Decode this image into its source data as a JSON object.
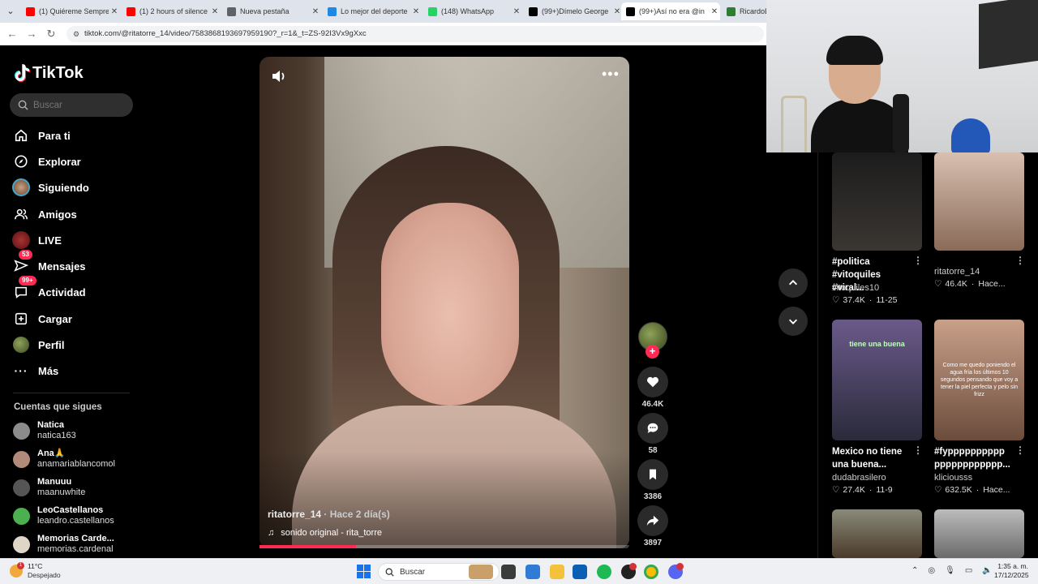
{
  "browser": {
    "tabs": [
      {
        "title": "(1) Quiéreme Sempre",
        "favicon_color": "#ff0000",
        "active": false
      },
      {
        "title": "(1) 2 hours of silence",
        "favicon_color": "#ff0000",
        "active": false
      },
      {
        "title": "Nueva pestaña",
        "favicon_color": "#5f6368",
        "active": false
      },
      {
        "title": "Lo mejor del deporte",
        "favicon_color": "#1e88e5",
        "active": false
      },
      {
        "title": "(148) WhatsApp",
        "favicon_color": "#25d366",
        "active": false
      },
      {
        "title": "(99+)Dímelo George",
        "favicon_color": "#000000",
        "active": false
      },
      {
        "title": "(99+)Así no era @in",
        "favicon_color": "#000000",
        "active": true
      },
      {
        "title": "RicardoEs",
        "favicon_color": "#2e7d32",
        "active": false
      }
    ],
    "url": "tiktok.com/@ritatorre_14/video/7583868193697959190?_r=1&_t=ZS-92I3Vx9gXxc"
  },
  "tiktok": {
    "logo_text": "TikTok",
    "search_placeholder": "Buscar",
    "nav": [
      {
        "label": "Para ti",
        "icon": "home-icon"
      },
      {
        "label": "Explorar",
        "icon": "compass-icon"
      },
      {
        "label": "Siguiendo",
        "icon": "following-avatar-icon"
      },
      {
        "label": "Amigos",
        "icon": "friends-icon"
      },
      {
        "label": "LIVE",
        "icon": "live-icon"
      },
      {
        "label": "Mensajes",
        "icon": "messages-icon",
        "badge": "53"
      },
      {
        "label": "Actividad",
        "icon": "activity-icon",
        "badge": "99+"
      },
      {
        "label": "Cargar",
        "icon": "upload-icon"
      },
      {
        "label": "Perfil",
        "icon": "profile-icon"
      },
      {
        "label": "Más",
        "icon": "more-dots-icon"
      }
    ],
    "following_title": "Cuentas que sigues",
    "following": [
      {
        "name": "Natica",
        "username": "natica163",
        "color": "#8c8c8c"
      },
      {
        "name": "Ana🙏",
        "username": "anamariablancomol",
        "color": "#b08a7a"
      },
      {
        "name": "Manuuu",
        "username": "maanuwhite",
        "color": "#555555"
      },
      {
        "name": "LeoCastellanos",
        "username": "leandro.castellanos",
        "color": "#4caf50"
      },
      {
        "name": "Memorias Carde...",
        "username": "memorias.cardenal",
        "color": "#e0d6c8"
      }
    ],
    "video": {
      "author": "ritatorre_14",
      "time_ago": "· Hace 2 día(s)",
      "sound": "sonido original - rita_torre",
      "progress": 0.26,
      "likes": "46.4K",
      "comments": "58",
      "saves": "3386",
      "shares": "3897"
    },
    "recommendations": [
      {
        "title": "#politica #vitoquiles #viral...",
        "user": "vitoquiles10",
        "likes": "37.4K",
        "date": "11-25",
        "thumb_text": "",
        "colors": [
          "#1c1c1c",
          "#3a3632"
        ]
      },
      {
        "title": "",
        "user": "ritatorre_14",
        "likes": "46.4K",
        "date": "Hace...",
        "thumb_text": "",
        "colors": [
          "#d8c0b0",
          "#8a6a58"
        ]
      },
      {
        "title": "Mexico no tiene una buena...",
        "user": "dudabrasilero",
        "likes": "27.4K",
        "date": "11-9",
        "thumb_text": "tiene una buena",
        "colors": [
          "#6a5a8a",
          "#2a2a3a"
        ]
      },
      {
        "title": "#fypppppppppp pppppppppppp...",
        "user": "kliciousss",
        "likes": "632.5K",
        "date": "Hace...",
        "thumb_text": "Como me quedo poniendo el agua fría los últimos 10 segundos pensando que voy a tener la piel perfecta y pelo sin frizz",
        "colors": [
          "#c9a089",
          "#6b4c3c"
        ]
      },
      {
        "title": "",
        "user": "",
        "likes": "",
        "date": "",
        "thumb_text": "",
        "colors": [
          "#8a8a7a",
          "#4a3a2a"
        ]
      },
      {
        "title": "",
        "user": "",
        "likes": "",
        "date": "",
        "thumb_text": "",
        "colors": [
          "#bcbcbc",
          "#6a6a6a"
        ]
      }
    ]
  },
  "taskbar": {
    "weather_temp": "11°C",
    "weather_cond": "Despejado",
    "weather_badge": "1",
    "search_placeholder": "Buscar",
    "time": "1:35 a. m.",
    "date": "17/12/2025"
  }
}
